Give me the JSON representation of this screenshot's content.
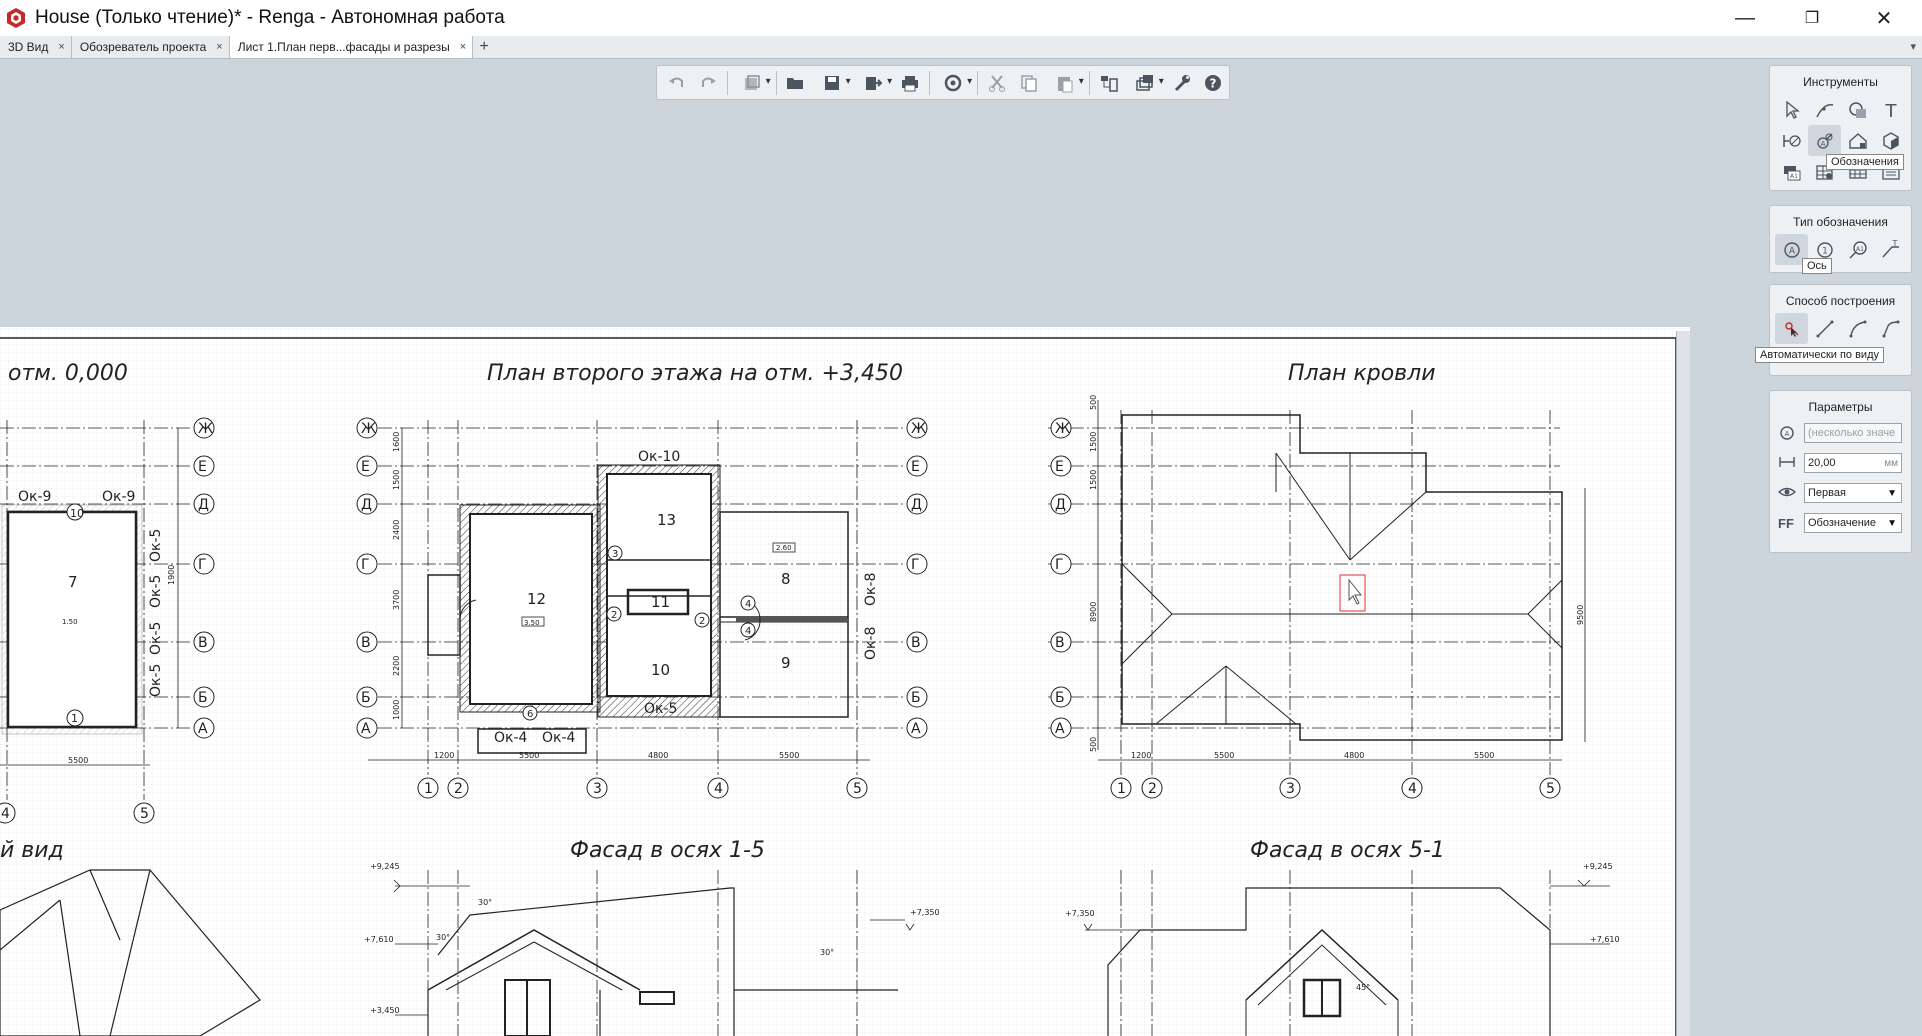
{
  "window": {
    "title": "House (Только чтение)* - Renga - Автономная работа",
    "minimize": "—",
    "maximize": "❐",
    "close": "✕"
  },
  "tabs": [
    {
      "label": "3D Вид",
      "close": "×"
    },
    {
      "label": "Обозреватель проекта",
      "close": "×"
    },
    {
      "label": "Лист 1.План перв...фасады и разрезы",
      "close": "×"
    }
  ],
  "tab_add": "+",
  "tab_menu": "▾",
  "toolbar": {
    "icons": [
      "undo-icon",
      "redo-icon",
      "model-icon",
      "open-icon",
      "save-icon",
      "export-icon",
      "print-icon",
      "cloud-icon",
      "cut-icon",
      "copy-icon",
      "paste-icon",
      "structure-icon",
      "layers-icon",
      "settings-icon",
      "help-icon"
    ]
  },
  "panels": {
    "tools": {
      "title": "Инструменты",
      "tooltip": "Обозначения"
    },
    "annotation_type": {
      "title": "Тип обозначения",
      "tooltip": "Ось"
    },
    "build_method": {
      "title": "Способ построения",
      "tooltip": "Автоматически по виду"
    },
    "parameters": {
      "title": "Параметры",
      "rows": [
        {
          "value": "(несколько значе",
          "unit": ""
        },
        {
          "value": "20,00",
          "unit": "мм"
        },
        {
          "value": "Первая",
          "unit": ""
        },
        {
          "value": "Обозначение",
          "unit": ""
        }
      ],
      "icon_ff": "FF"
    }
  },
  "drawing": {
    "titles": {
      "plan1": "отм. 0,000",
      "plan2": "План второго этажа на отм. +3,450",
      "roof": "План кровли",
      "view3d": "й вид",
      "facade15": "Фасад в осях 1-5",
      "facade51": "Фасад в осях 5-1"
    },
    "axes_rows": [
      "Ж",
      "Е",
      "Д",
      "Г",
      "В",
      "Б",
      "А"
    ],
    "axes_cols": [
      "1",
      "2",
      "3",
      "4",
      "5"
    ],
    "plan1_axis_labels": [
      "4",
      "5"
    ],
    "rooms": {
      "r7": "7",
      "r12": "12",
      "r13": "13",
      "r11": "11",
      "r10": "10",
      "r8": "8",
      "r9": "9"
    },
    "windows": {
      "ok9a": "Ок-9",
      "ok9b": "Ок-9",
      "ok5a": "Ок-5",
      "ok5b": "Ок-5",
      "ok5c": "Ок-5",
      "ok5d": "Ок-5",
      "ok10": "Ок-10",
      "ok4a": "Ок-4",
      "ok4b": "Ок-4",
      "ok5e": "Ок-5",
      "ok8a": "Ок-8",
      "ok8b": "Ок-8"
    },
    "door_marks": [
      "10",
      "1",
      "3",
      "2",
      "2",
      "4",
      "4",
      "6"
    ],
    "dims": {
      "plan1_bottom": "5500",
      "plan1_side": "1900",
      "plan2_b1": "1200",
      "plan2_b2": "5500",
      "plan2_b3": "4800",
      "plan2_b4": "5500",
      "plan2_s1": "1600",
      "plan2_s2": "1500",
      "plan2_s3": "2400",
      "plan2_s4": "3700",
      "plan2_s5": "2200",
      "plan2_s6": "1000",
      "roof_b1": "1200",
      "roof_b2": "5500",
      "roof_b3": "4800",
      "roof_b4": "5500",
      "roof_s1": "500",
      "roof_s2": "1500",
      "roof_s3": "1500",
      "roof_s4": "8900",
      "roof_s5": "500",
      "roof_right": "9500"
    },
    "levels": {
      "f1_top": "+9,245",
      "f1_mid": "+7,610",
      "f1_low": "+3,450",
      "f1_right": "+7,350",
      "f2_top": "+9,245",
      "f2_left": "+7,350",
      "f2_right": "+7,610"
    },
    "angles": [
      "30°",
      "30°",
      "30°",
      "45°"
    ],
    "small_tags": [
      "1.50",
      "3.50",
      "2.60"
    ]
  }
}
